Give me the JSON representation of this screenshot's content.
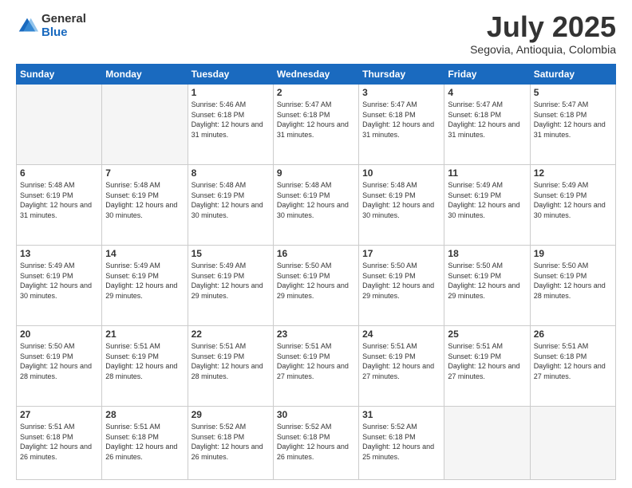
{
  "header": {
    "logo_general": "General",
    "logo_blue": "Blue",
    "month_title": "July 2025",
    "subtitle": "Segovia, Antioquia, Colombia"
  },
  "weekdays": [
    "Sunday",
    "Monday",
    "Tuesday",
    "Wednesday",
    "Thursday",
    "Friday",
    "Saturday"
  ],
  "weeks": [
    [
      {
        "day": "",
        "info": "",
        "empty": true
      },
      {
        "day": "",
        "info": "",
        "empty": true
      },
      {
        "day": "1",
        "info": "Sunrise: 5:46 AM\nSunset: 6:18 PM\nDaylight: 12 hours and 31 minutes."
      },
      {
        "day": "2",
        "info": "Sunrise: 5:47 AM\nSunset: 6:18 PM\nDaylight: 12 hours and 31 minutes."
      },
      {
        "day": "3",
        "info": "Sunrise: 5:47 AM\nSunset: 6:18 PM\nDaylight: 12 hours and 31 minutes."
      },
      {
        "day": "4",
        "info": "Sunrise: 5:47 AM\nSunset: 6:18 PM\nDaylight: 12 hours and 31 minutes."
      },
      {
        "day": "5",
        "info": "Sunrise: 5:47 AM\nSunset: 6:18 PM\nDaylight: 12 hours and 31 minutes."
      }
    ],
    [
      {
        "day": "6",
        "info": "Sunrise: 5:48 AM\nSunset: 6:19 PM\nDaylight: 12 hours and 31 minutes."
      },
      {
        "day": "7",
        "info": "Sunrise: 5:48 AM\nSunset: 6:19 PM\nDaylight: 12 hours and 30 minutes."
      },
      {
        "day": "8",
        "info": "Sunrise: 5:48 AM\nSunset: 6:19 PM\nDaylight: 12 hours and 30 minutes."
      },
      {
        "day": "9",
        "info": "Sunrise: 5:48 AM\nSunset: 6:19 PM\nDaylight: 12 hours and 30 minutes."
      },
      {
        "day": "10",
        "info": "Sunrise: 5:48 AM\nSunset: 6:19 PM\nDaylight: 12 hours and 30 minutes."
      },
      {
        "day": "11",
        "info": "Sunrise: 5:49 AM\nSunset: 6:19 PM\nDaylight: 12 hours and 30 minutes."
      },
      {
        "day": "12",
        "info": "Sunrise: 5:49 AM\nSunset: 6:19 PM\nDaylight: 12 hours and 30 minutes."
      }
    ],
    [
      {
        "day": "13",
        "info": "Sunrise: 5:49 AM\nSunset: 6:19 PM\nDaylight: 12 hours and 30 minutes."
      },
      {
        "day": "14",
        "info": "Sunrise: 5:49 AM\nSunset: 6:19 PM\nDaylight: 12 hours and 29 minutes."
      },
      {
        "day": "15",
        "info": "Sunrise: 5:49 AM\nSunset: 6:19 PM\nDaylight: 12 hours and 29 minutes."
      },
      {
        "day": "16",
        "info": "Sunrise: 5:50 AM\nSunset: 6:19 PM\nDaylight: 12 hours and 29 minutes."
      },
      {
        "day": "17",
        "info": "Sunrise: 5:50 AM\nSunset: 6:19 PM\nDaylight: 12 hours and 29 minutes."
      },
      {
        "day": "18",
        "info": "Sunrise: 5:50 AM\nSunset: 6:19 PM\nDaylight: 12 hours and 29 minutes."
      },
      {
        "day": "19",
        "info": "Sunrise: 5:50 AM\nSunset: 6:19 PM\nDaylight: 12 hours and 28 minutes."
      }
    ],
    [
      {
        "day": "20",
        "info": "Sunrise: 5:50 AM\nSunset: 6:19 PM\nDaylight: 12 hours and 28 minutes."
      },
      {
        "day": "21",
        "info": "Sunrise: 5:51 AM\nSunset: 6:19 PM\nDaylight: 12 hours and 28 minutes."
      },
      {
        "day": "22",
        "info": "Sunrise: 5:51 AM\nSunset: 6:19 PM\nDaylight: 12 hours and 28 minutes."
      },
      {
        "day": "23",
        "info": "Sunrise: 5:51 AM\nSunset: 6:19 PM\nDaylight: 12 hours and 27 minutes."
      },
      {
        "day": "24",
        "info": "Sunrise: 5:51 AM\nSunset: 6:19 PM\nDaylight: 12 hours and 27 minutes."
      },
      {
        "day": "25",
        "info": "Sunrise: 5:51 AM\nSunset: 6:19 PM\nDaylight: 12 hours and 27 minutes."
      },
      {
        "day": "26",
        "info": "Sunrise: 5:51 AM\nSunset: 6:18 PM\nDaylight: 12 hours and 27 minutes."
      }
    ],
    [
      {
        "day": "27",
        "info": "Sunrise: 5:51 AM\nSunset: 6:18 PM\nDaylight: 12 hours and 26 minutes."
      },
      {
        "day": "28",
        "info": "Sunrise: 5:51 AM\nSunset: 6:18 PM\nDaylight: 12 hours and 26 minutes."
      },
      {
        "day": "29",
        "info": "Sunrise: 5:52 AM\nSunset: 6:18 PM\nDaylight: 12 hours and 26 minutes."
      },
      {
        "day": "30",
        "info": "Sunrise: 5:52 AM\nSunset: 6:18 PM\nDaylight: 12 hours and 26 minutes."
      },
      {
        "day": "31",
        "info": "Sunrise: 5:52 AM\nSunset: 6:18 PM\nDaylight: 12 hours and 25 minutes."
      },
      {
        "day": "",
        "info": "",
        "empty": true
      },
      {
        "day": "",
        "info": "",
        "empty": true
      }
    ]
  ]
}
